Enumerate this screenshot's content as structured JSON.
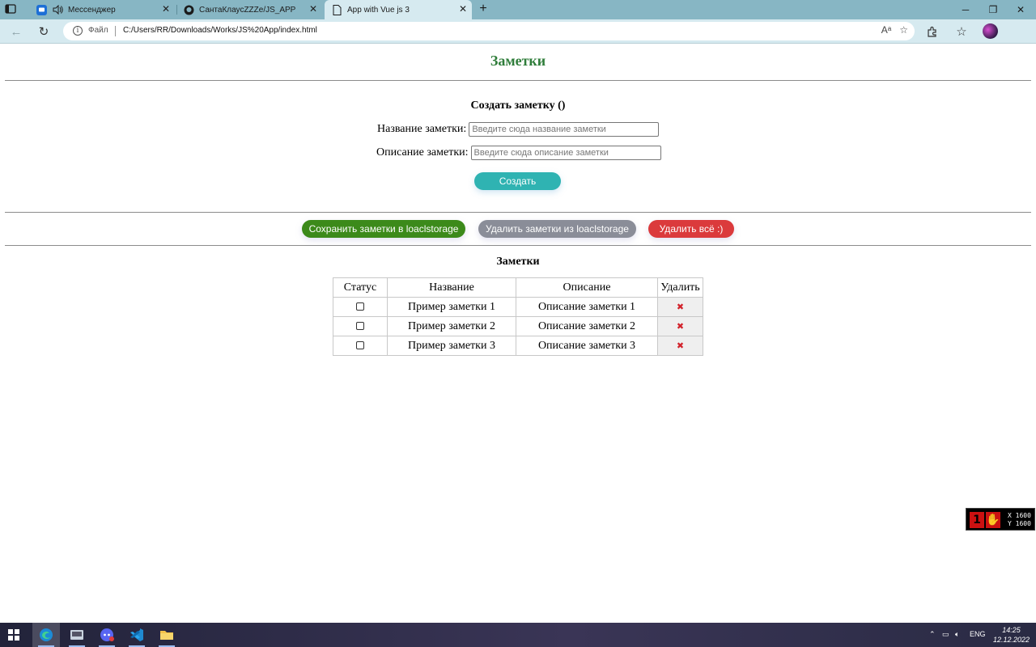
{
  "browser": {
    "tabs": [
      {
        "title": "Мессенджер"
      },
      {
        "title": "СантаКлаусZZZe/JS_APP"
      },
      {
        "title": "App with Vue js 3"
      }
    ],
    "address": {
      "scheme_label": "Файл",
      "url": "C:/Users/RR/Downloads/Works/JS%20App/index.html"
    }
  },
  "page": {
    "title": "Заметки",
    "form": {
      "heading": "Создать заметку ()",
      "name_label": "Название заметки:",
      "name_placeholder": "Введите сюда название заметки",
      "desc_label": "Описание заметки:",
      "desc_placeholder": "Введите сюда описание заметки",
      "create_label": "Создать"
    },
    "actions": {
      "save_label": "Сохранить заметки в loaclstorage",
      "remove_label": "Удалить заметки из loaclstorage",
      "delete_all_label": "Удалить всё :)"
    },
    "notes": {
      "heading": "Заметки",
      "columns": [
        "Статус",
        "Название",
        "Описание",
        "Удалить"
      ],
      "rows": [
        {
          "name": "Пример заметки 1",
          "description": "Описание заметки 1",
          "done": false,
          "delete_glyph": "✖"
        },
        {
          "name": "Пример заметки 2",
          "description": "Описание заметки 2",
          "done": false,
          "delete_glyph": "✖"
        },
        {
          "name": "Пример заметки 3",
          "description": "Описание заметки 3",
          "done": false,
          "delete_glyph": "✖"
        }
      ]
    },
    "overlay_badge": {
      "x_label": "X 1600",
      "y_label": "Y 1600"
    }
  },
  "taskbar": {
    "tray_lang": "ENG",
    "time": "14:25",
    "date": "12.12.2022"
  },
  "colors": {
    "title_green": "#2f7d3a",
    "create_teal": "#2fb3b2",
    "save_green": "#3c8a1a",
    "remove_gray": "#8a8d98",
    "delete_red": "#db3a3c"
  }
}
